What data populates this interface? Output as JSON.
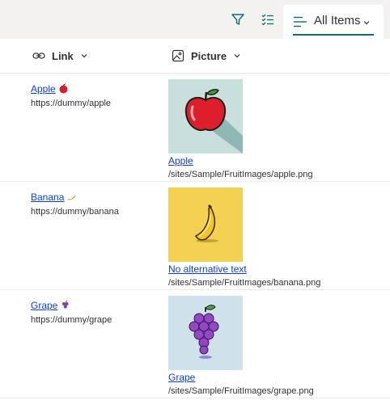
{
  "toolbar": {
    "view_label": "All Items",
    "icons": [
      "filter-icon",
      "edit-view-icon",
      "view-list-icon",
      "chevron-down-icon"
    ]
  },
  "columns": {
    "link": {
      "label": "Link",
      "icon": "link-icon"
    },
    "picture": {
      "label": "Picture",
      "icon": "image-icon"
    }
  },
  "rows": [
    {
      "title": "Apple",
      "emoji": "apple-icon",
      "url": "https://dummy/apple",
      "picture_alt": "Apple",
      "picture_path": "/sites/Sample/FruitImages/apple.png",
      "thumb_bg": "#c9dfdc"
    },
    {
      "title": "Banana",
      "emoji": "banana-icon",
      "url": "https://dummy/banana",
      "picture_alt": "No alternative text",
      "picture_path": "/sites/Sample/FruitImages/banana.png",
      "thumb_bg": "#f3d152"
    },
    {
      "title": "Grape",
      "emoji": "grape-icon",
      "url": "https://dummy/grape",
      "picture_alt": "Grape",
      "picture_path": "/sites/Sample/FruitImages/grape.png",
      "thumb_bg": "#cfe2ea"
    }
  ],
  "colors": {
    "accent": "#0f6d6a",
    "link": "#0b3ede",
    "toolbar_bg": "#f3f2f1"
  }
}
